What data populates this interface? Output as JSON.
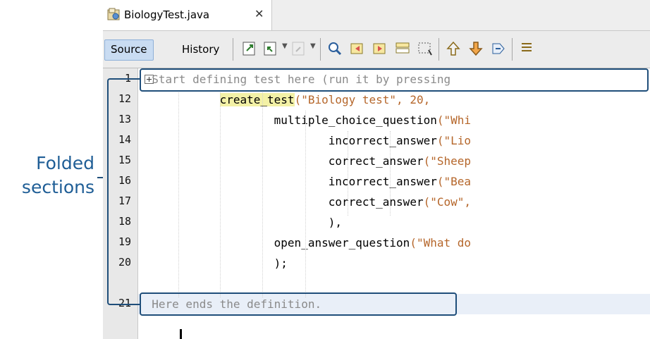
{
  "annotation": {
    "line1": "Folded",
    "line2": "sections"
  },
  "tab": {
    "file_name": "BiologyTest.java",
    "close": "✕"
  },
  "toolbar": {
    "source_label": "Source",
    "history_label": "History",
    "icons": [
      "last-edit-icon",
      "back-icon",
      "forward-icon",
      "find-icon",
      "prev-occurrence-icon",
      "next-occurrence-icon",
      "toggle-highlight-icon",
      "toggle-rect-select-icon",
      "prev-bookmark-icon",
      "next-bookmark-icon",
      "toggle-bookmark-icon",
      "shift-left-icon"
    ]
  },
  "code": {
    "lines": [
      {
        "num": "1",
        "fold": true,
        "text": "Start defining test here (run it by pressing"
      },
      {
        "num": "12",
        "indent": "            ",
        "fn": "create_test",
        "args": "(\"Biology test\", 20,"
      },
      {
        "num": "13",
        "indent": "                    ",
        "fn": "multiple_choice_question",
        "args": "(\"Whi"
      },
      {
        "num": "14",
        "indent": "                            ",
        "fn": "incorrect_answer",
        "args": "(\"Lio"
      },
      {
        "num": "15",
        "indent": "                            ",
        "fn": "correct_answer",
        "args": "(\"Sheep"
      },
      {
        "num": "16",
        "indent": "                            ",
        "fn": "incorrect_answer",
        "args": "(\"Bea"
      },
      {
        "num": "17",
        "indent": "                            ",
        "fn": "correct_answer",
        "args": "(\"Cow\","
      },
      {
        "num": "18",
        "indent": "                            ",
        "fn": "",
        "args": "),"
      },
      {
        "num": "19",
        "indent": "                    ",
        "fn": "open_answer_question",
        "args": "(\"What do"
      },
      {
        "num": "20",
        "indent": "                    ",
        "fn": "",
        "args": ");"
      },
      {
        "num": "21",
        "fold": true,
        "text": "Here ends the definition."
      }
    ]
  },
  "colors": {
    "callout": "#1f4e7a",
    "annotation_text": "#1f5e96",
    "string": "#b5662a",
    "highlight": "#f3f1a6"
  }
}
